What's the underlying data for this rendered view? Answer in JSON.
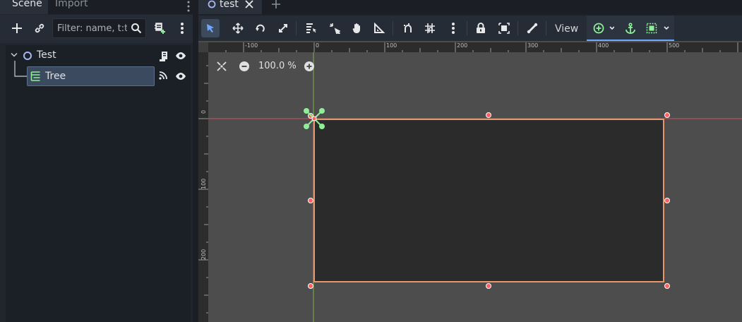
{
  "scene_dock": {
    "tabs": [
      {
        "label": "Scene"
      },
      {
        "label": "Import"
      }
    ],
    "filter": {
      "placeholder": "Filter: name, t:t"
    },
    "tree": {
      "root": {
        "label": "Test"
      },
      "child": {
        "label": "Tree"
      }
    }
  },
  "editor": {
    "tab": {
      "label": "test"
    },
    "toolbar": {
      "view_label": "View"
    },
    "zoom": {
      "value": "100.0 %"
    },
    "ruler_top": [
      "-100",
      "0",
      "100",
      "200",
      "300",
      "400",
      "500"
    ],
    "ruler_left": [
      "0",
      "100",
      "200"
    ]
  },
  "colors": {
    "accent": "#6ea8ff",
    "node_green": "#8eef97",
    "selection_outline": "#e8956b",
    "handle_red": "#ff5f5f",
    "control_fill": "#2b2b2b",
    "viewport_bg": "#4d4d4d"
  },
  "icons": {
    "select": "select-arrow-icon",
    "move": "move-icon",
    "rotate": "rotate-icon",
    "scale": "scale-icon",
    "lock": "lock-icon",
    "anchor": "anchor-icon"
  }
}
